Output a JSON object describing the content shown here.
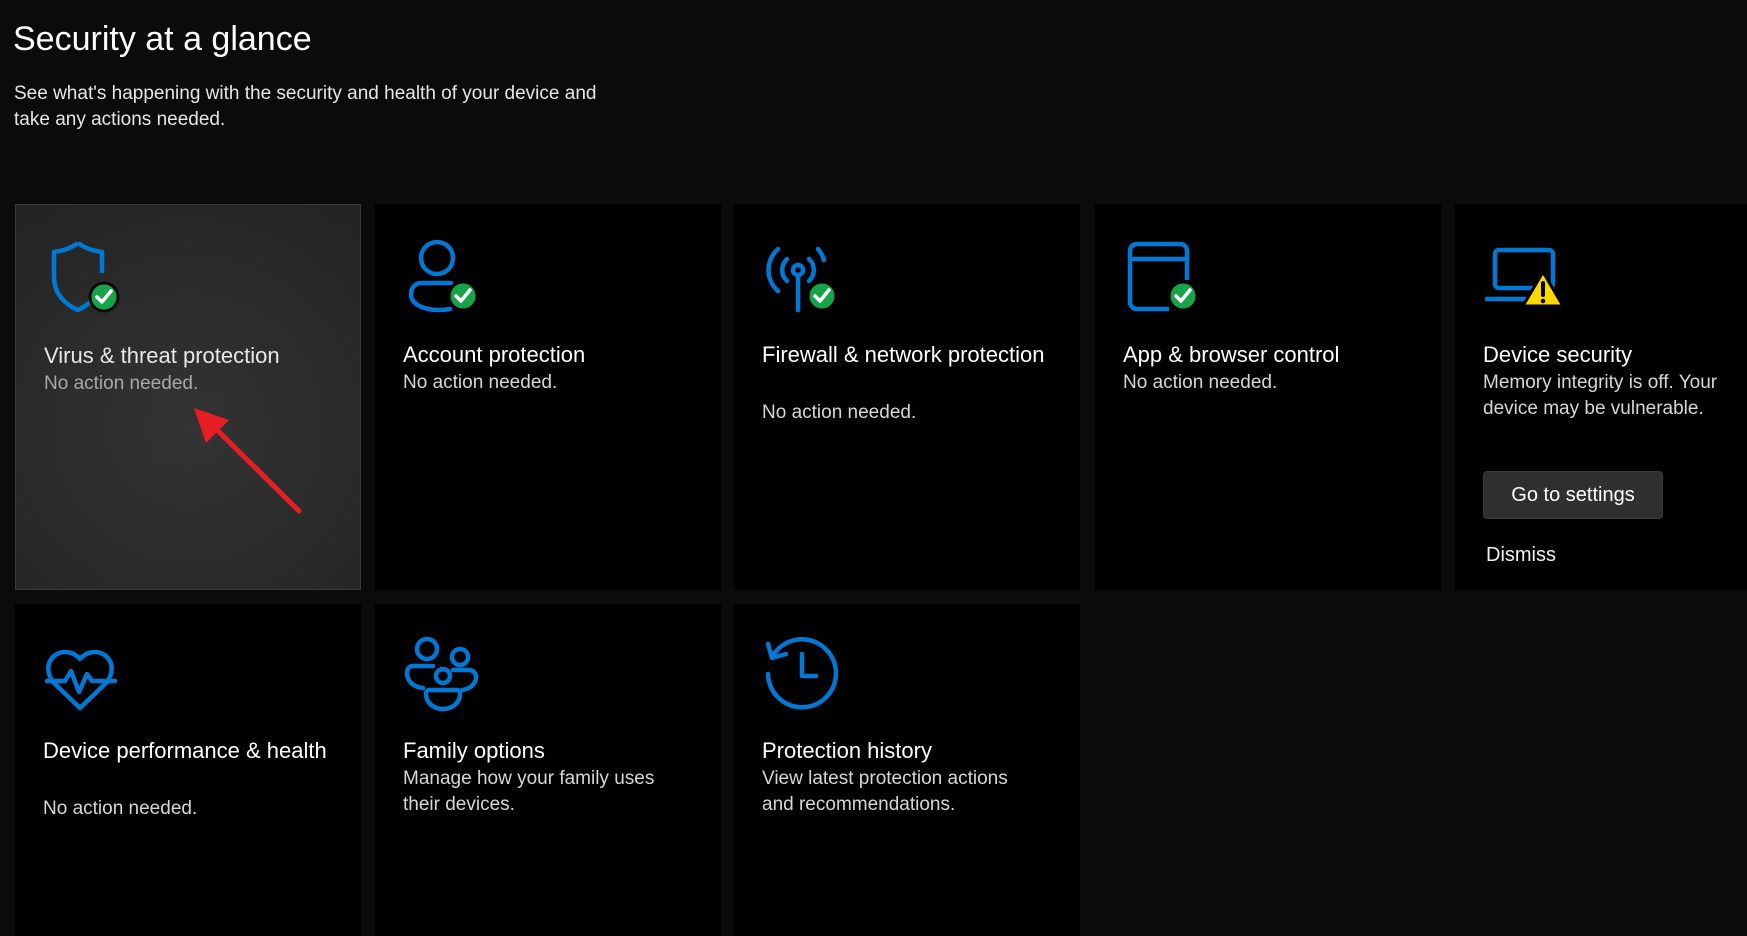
{
  "header": {
    "title": "Security at a glance",
    "subtitle": "See what's happening with the security and health of your device and take any actions needed."
  },
  "colors": {
    "accent": "#0078d4",
    "ok_badge": "#16a34a",
    "warning": "#ffd800",
    "annotation_arrow": "#e81e25"
  },
  "tiles": [
    {
      "title": "Virus & threat protection",
      "status": "No action needed.",
      "icon": "shield-check-icon",
      "state": "ok"
    },
    {
      "title": "Account protection",
      "status": "No action needed.",
      "icon": "person-check-icon",
      "state": "ok"
    },
    {
      "title": "Firewall & network protection",
      "status": "No action needed.",
      "icon": "antenna-check-icon",
      "state": "ok"
    },
    {
      "title": "App & browser control",
      "status": "No action needed.",
      "icon": "browser-window-check-icon",
      "state": "ok"
    },
    {
      "title": "Device security",
      "status": "Memory integrity is off. Your device may be vulnerable.",
      "icon": "laptop-warning-icon",
      "state": "warning",
      "action_label": "Go to settings",
      "dismiss_label": "Dismiss"
    },
    {
      "title": "Device performance & health",
      "status": "No action needed.",
      "icon": "heart-pulse-icon",
      "state": "ok"
    },
    {
      "title": "Family options",
      "status": "Manage how your family uses their devices.",
      "icon": "family-icon",
      "state": "info"
    },
    {
      "title": "Protection history",
      "status": "View latest protection actions and recommendations.",
      "icon": "history-clock-icon",
      "state": "info"
    }
  ]
}
